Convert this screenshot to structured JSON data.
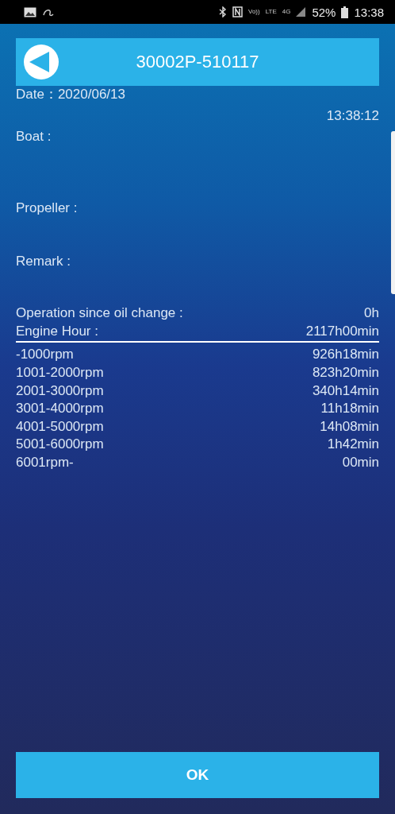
{
  "status_bar": {
    "network": [
      "Vo))",
      "LTE",
      "4G"
    ],
    "battery": "52%",
    "time": "13:38"
  },
  "header": {
    "title": "30002P-510117"
  },
  "date": "Date：2020/06/13",
  "clock": "13:38:12",
  "fields": [
    {
      "label": "Boat :"
    },
    {
      "label": "Propeller :"
    },
    {
      "label": "Remark :"
    }
  ],
  "summary": [
    {
      "label": "Operation since oil change :",
      "value": "0h"
    },
    {
      "label": "Engine Hour :",
      "value": "2117h00min"
    }
  ],
  "rpm_rows": [
    {
      "label": "-1000rpm",
      "value": "926h18min"
    },
    {
      "label": "1001-2000rpm",
      "value": "823h20min"
    },
    {
      "label": "2001-3000rpm",
      "value": "340h14min"
    },
    {
      "label": "3001-4000rpm",
      "value": "11h18min"
    },
    {
      "label": "4001-5000rpm",
      "value": "14h08min"
    },
    {
      "label": "5001-6000rpm",
      "value": "1h42min"
    },
    {
      "label": "6001rpm-",
      "value": "00min"
    }
  ],
  "ok_button": "OK"
}
